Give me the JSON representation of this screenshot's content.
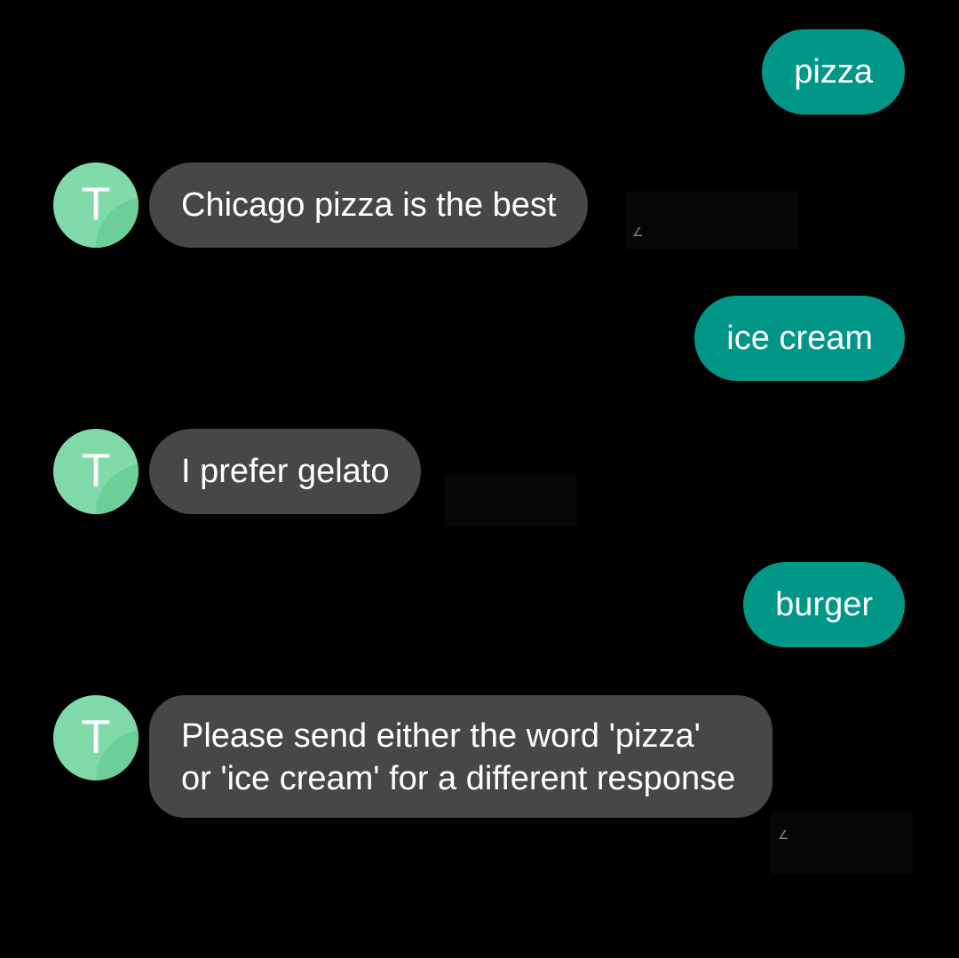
{
  "conversation": {
    "messages": [
      {
        "direction": "outgoing",
        "text": "pizza"
      },
      {
        "direction": "incoming",
        "sender_initial": "T",
        "text": "Chicago pizza is the best"
      },
      {
        "direction": "outgoing",
        "text": "ice cream"
      },
      {
        "direction": "incoming",
        "sender_initial": "T",
        "text": "I prefer gelato"
      },
      {
        "direction": "outgoing",
        "text": "burger"
      },
      {
        "direction": "incoming",
        "sender_initial": "T",
        "text": "Please send either the word 'pizza' or 'ice cream' for a different response"
      }
    ]
  },
  "colors": {
    "background": "#000000",
    "outgoing_bubble": "#009688",
    "incoming_bubble": "#474747",
    "avatar": "#7fd9a8",
    "text": "#ffffff"
  },
  "icons": {
    "avatar": "letter-avatar-icon"
  }
}
